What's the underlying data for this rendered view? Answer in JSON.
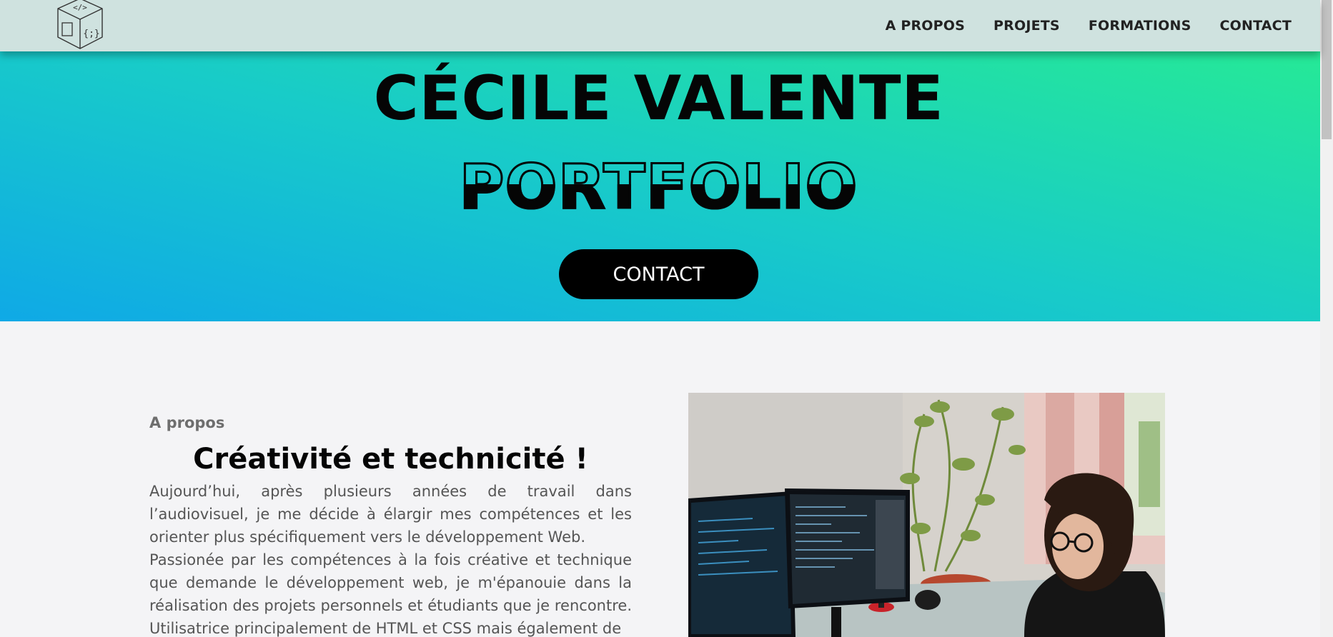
{
  "nav": {
    "logo_glyphs": [
      "</>",
      "{;}"
    ],
    "items": [
      {
        "label": "A PROPOS"
      },
      {
        "label": "PROJETS"
      },
      {
        "label": "FORMATIONS"
      },
      {
        "label": "CONTACT"
      }
    ]
  },
  "hero": {
    "name": "CÉCILE VALENTE",
    "subtitle": "PORTFOLIO",
    "button_label": "CONTACT"
  },
  "about": {
    "kicker": "A propos",
    "title": "Créativité et technicité !",
    "paragraphs": [
      "Aujourd’hui, après plusieurs années de travail dans l’audiovisuel, je me décide à élargir mes compétences et les orienter plus spécifiquement vers le développement Web.",
      "Passionée par les compétences à la fois créative et technique que demande le développement web, je m'épanouie dans la réalisation des projets personnels et étudiants que je rencontre. Utilisatrice principalement de HTML et CSS mais également de"
    ]
  },
  "colors": {
    "gradient_start": "#0fa9e6",
    "gradient_end": "#28ee8e",
    "navbar_bg": "#cfe2df",
    "page_bg": "#f4f4f6",
    "button_bg": "#000000"
  }
}
